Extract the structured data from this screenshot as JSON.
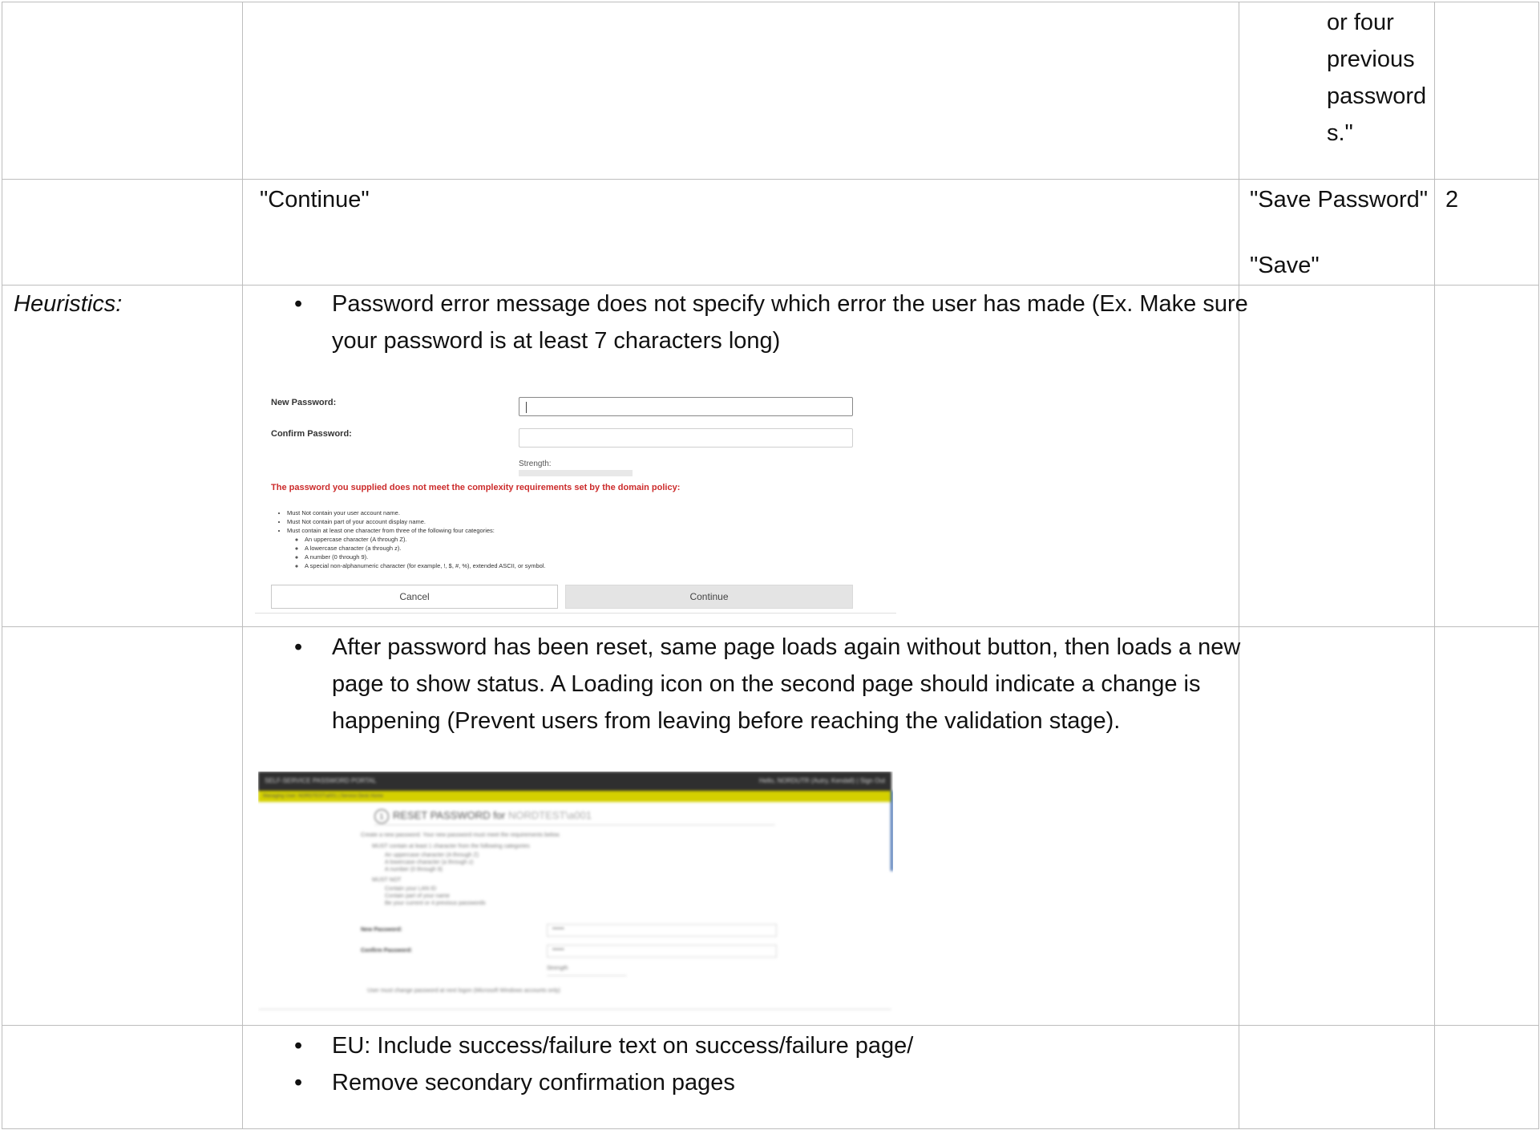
{
  "row1": {
    "col3_lines": [
      "or four",
      "previous",
      "password",
      "s.\""
    ]
  },
  "row2": {
    "col2": "\"Continue\"",
    "col3_line1": "\"Save Password\"",
    "col3_line2": "\"Save\"",
    "col4": "2"
  },
  "row3": {
    "label": "Heuristics:",
    "bullet_line1": "Password error message does not specify which error the user has made (Ex. Make sure",
    "bullet_line2": "your password is at least 7 characters long)",
    "bullet_symbol": "•",
    "screenshot": {
      "new_password_label": "New Password:",
      "confirm_password_label": "Confirm Password:",
      "strength_label": "Strength:",
      "error_text": "The password you supplied does not meet the complexity requirements set by the domain policy:",
      "rules": [
        "Must Not contain your user account name.",
        "Must Not contain part of your account display name.",
        "Must contain at least one character from three of the following four categories:"
      ],
      "categories": [
        "An uppercase character (A through Z).",
        "A lowercase character (a through z).",
        "A number (0 through 9).",
        "A special non-alphanumeric character (for example, !, $, #, %), extended ASCII, or symbol."
      ],
      "cancel_label": "Cancel",
      "continue_label": "Continue"
    }
  },
  "row4": {
    "bullet_line1": "After password has been reset, same page loads again without button, then loads a new",
    "bullet_line2": "page to show status. A Loading icon on the second page should indicate a change is",
    "bullet_line3": "happening (Prevent users from leaving before reaching the validation stage).",
    "screenshot": {
      "topbar_title": "SELF-SERVICE PASSWORD PORTAL",
      "topbar_user": "Hello, NORDUTR (Autry, Kendall) | Sign Out",
      "subbar": "Managing User: NORDTEST\\a001 | Service Desk Home",
      "step_number": "1",
      "title_main": "RESET PASSWORD for ",
      "title_user": "NORDTEST\\a001",
      "intro": "Create a new password. Your new password must meet the requirements below.",
      "req1": "MUST contain at least 1 character from the following categories",
      "req1_items": [
        "An uppercase character (A through Z)",
        "A lowercase character (a through z)",
        "A number (0 through 9)"
      ],
      "req2": "MUST NOT",
      "req2_items": [
        "Contain your LAN ID",
        "Contain part of your name",
        "Be your current or 4 previous passwords"
      ],
      "new_password": "New Password:",
      "confirm_password": "Confirm Password:",
      "new_value": "••••••",
      "confirm_value": "••••••",
      "strength": "Strength",
      "checkbox_text": "User must change password at next logon (Microsoft Windows accounts only)"
    }
  },
  "row5": {
    "bullet1": "EU: Include success/failure text on success/failure page/",
    "bullet2": "Remove secondary confirmation pages"
  }
}
